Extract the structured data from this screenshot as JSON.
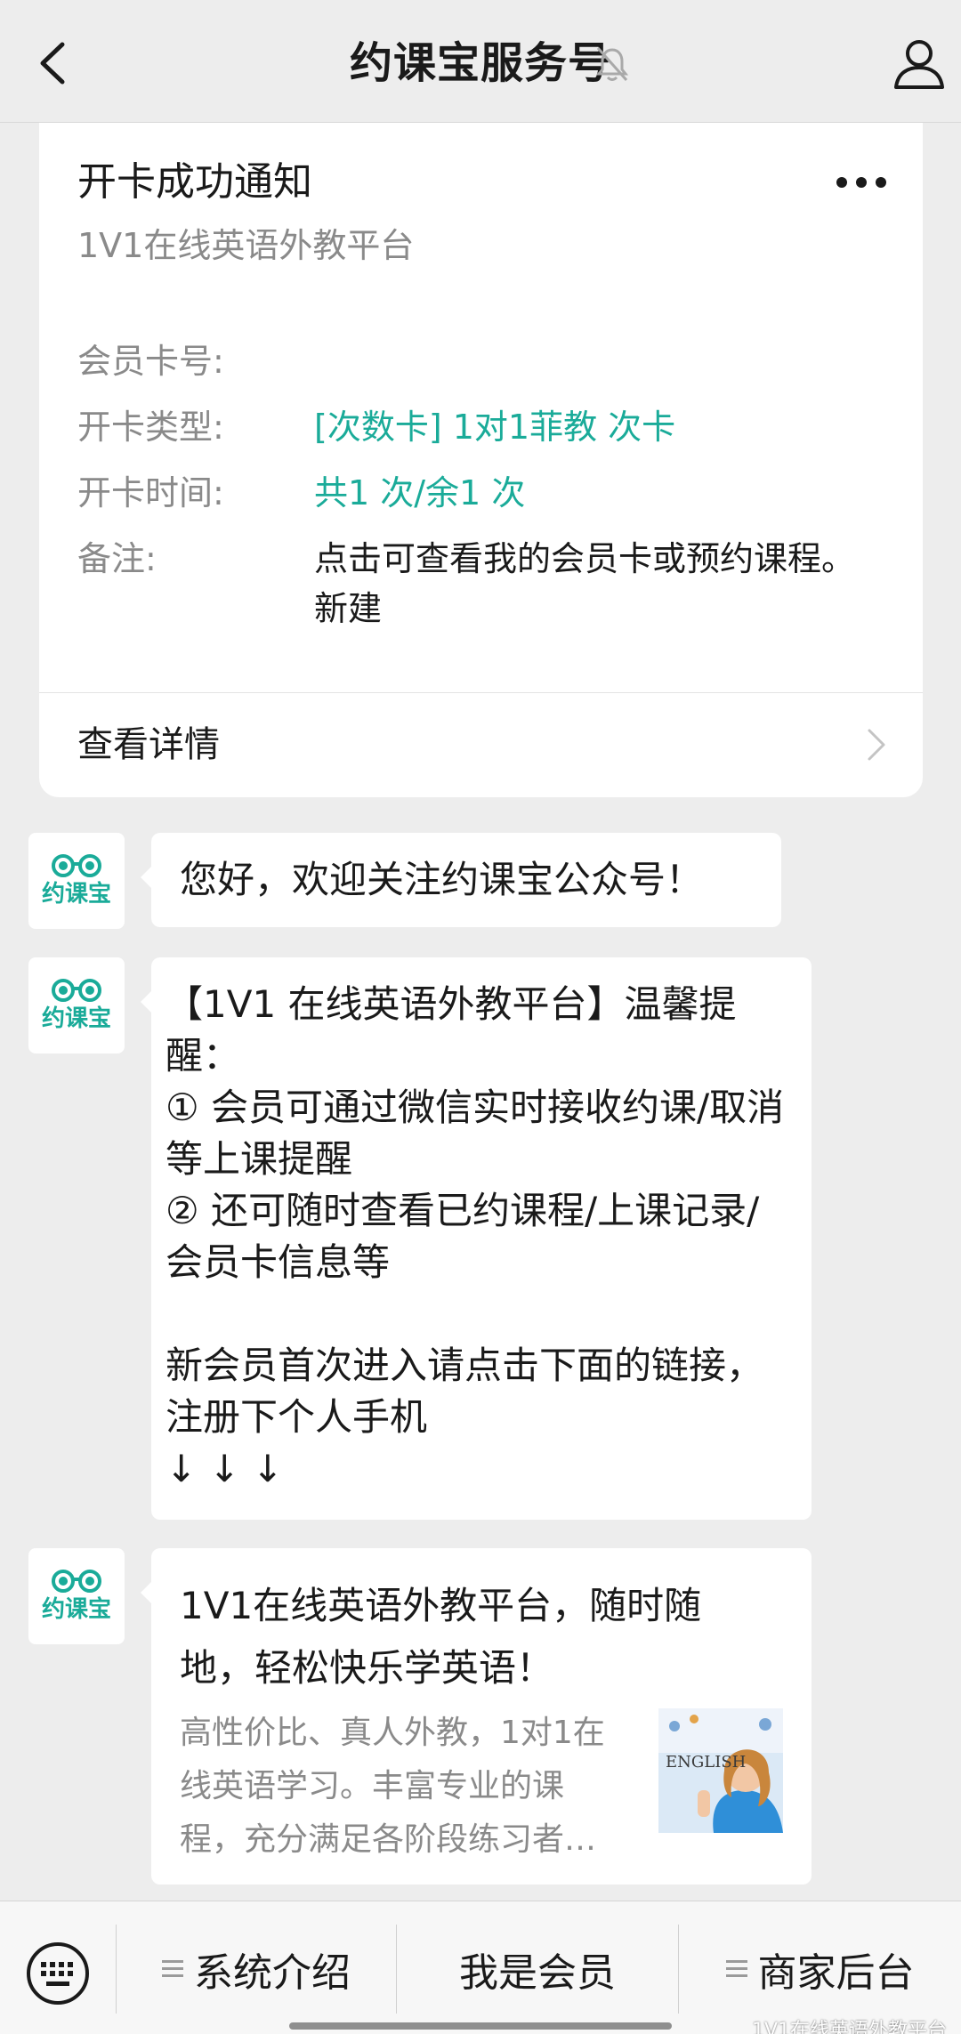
{
  "header": {
    "title": "约课宝服务号"
  },
  "card": {
    "title": "开卡成功通知",
    "subtitle": "1V1在线英语外教平台",
    "rows": [
      {
        "label": "会员卡号:",
        "value": ""
      },
      {
        "label": "开卡类型:",
        "value": "[次数卡] 1对1菲教  次卡"
      },
      {
        "label": "开卡时间:",
        "value": "共1   次/余1   次"
      },
      {
        "label": "备注:",
        "value": "点击可查看我的会员卡或预约课程。新建"
      }
    ],
    "detail_label": "查看详情"
  },
  "avatar_brand": "约课宝",
  "messages": {
    "welcome": "您好，欢迎关注约课宝公众号！",
    "reminder": "【1V1 在线英语外教平台】温馨提醒：\n① 会员可通过微信实时接收约课/取消等上课提醒\n② 还可随时查看已约课程/上课记录/会员卡信息等\n\n新会员首次进入请点击下面的链接，注册下个人手机\n↓ ↓ ↓",
    "link_title": "1V1在线英语外教平台，随时随地，轻松快乐学英语！",
    "link_desc": "高性价比、真人外教，1对1在线英语学习。丰富专业的课程，充分满足各阶段练习者…",
    "link_thumb_text": "ENGLISH"
  },
  "menu": {
    "items": [
      "系统介绍",
      "我是会员",
      "商家后台"
    ]
  },
  "watermark": "1V1在线英语外教平台",
  "colors": {
    "accent": "#1aab99",
    "background": "#ededed",
    "card": "#ffffff",
    "secondary_text": "#8a8a8a"
  }
}
